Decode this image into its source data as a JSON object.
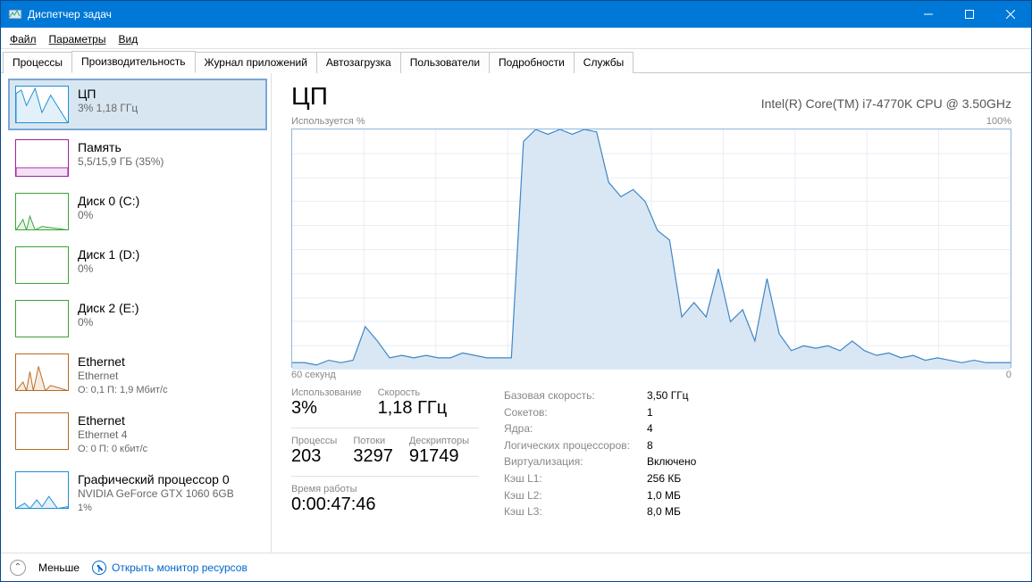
{
  "window": {
    "title": "Диспетчер задач"
  },
  "menu": {
    "file": "Файл",
    "options": "Параметры",
    "view": "Вид"
  },
  "tabs": {
    "processes": "Процессы",
    "performance": "Производительность",
    "apphistory": "Журнал приложений",
    "startup": "Автозагрузка",
    "users": "Пользователи",
    "details": "Подробности",
    "services": "Службы",
    "active": "performance"
  },
  "sidebar": {
    "items": [
      {
        "id": "cpu",
        "title": "ЦП",
        "sub": "3%  1,18 ГГц",
        "color": "#1e90d4"
      },
      {
        "id": "memory",
        "title": "Память",
        "sub": "5,5/15,9 ГБ (35%)",
        "color": "#a020a0"
      },
      {
        "id": "disk0",
        "title": "Диск 0 (C:)",
        "sub": "0%",
        "color": "#3aa43a"
      },
      {
        "id": "disk1",
        "title": "Диск 1 (D:)",
        "sub": "0%",
        "color": "#3aa43a"
      },
      {
        "id": "disk2",
        "title": "Диск 2 (E:)",
        "sub": "0%",
        "color": "#3aa43a"
      },
      {
        "id": "eth0",
        "title": "Ethernet",
        "sub": "Ethernet",
        "sub2": "О: 0,1 П: 1,9 Мбит/с",
        "color": "#b86b1f"
      },
      {
        "id": "eth1",
        "title": "Ethernet",
        "sub": "Ethernet 4",
        "sub2": "О: 0 П: 0 кбит/с",
        "color": "#b86b1f"
      },
      {
        "id": "gpu",
        "title": "Графический процессор 0",
        "sub": "NVIDIA GeForce GTX 1060 6GB",
        "sub2": "1%",
        "color": "#1e90d4"
      }
    ]
  },
  "main": {
    "title": "ЦП",
    "device": "Intel(R) Core(TM) i7-4770K CPU @ 3.50GHz",
    "chart_top_left": "Используется %",
    "chart_top_right": "100%",
    "chart_bottom_left": "60 секунд",
    "chart_bottom_right": "0"
  },
  "stats": {
    "left_row1": [
      {
        "lbl": "Использование",
        "val": "3%"
      },
      {
        "lbl": "Скорость",
        "val": "1,18 ГГц"
      }
    ],
    "left_row2": [
      {
        "lbl": "Процессы",
        "val": "203"
      },
      {
        "lbl": "Потоки",
        "val": "3297"
      },
      {
        "lbl": "Дескрипторы",
        "val": "91749"
      }
    ],
    "uptime_lbl": "Время работы",
    "uptime_val": "0:00:47:46",
    "right": [
      {
        "k": "Базовая скорость:",
        "v": "3,50 ГГц"
      },
      {
        "k": "Сокетов:",
        "v": "1"
      },
      {
        "k": "Ядра:",
        "v": "4"
      },
      {
        "k": "Логических процессоров:",
        "v": "8"
      },
      {
        "k": "Виртуализация:",
        "v": "Включено"
      },
      {
        "k": "Кэш L1:",
        "v": "256 КБ"
      },
      {
        "k": "Кэш L2:",
        "v": "1,0 МБ"
      },
      {
        "k": "Кэш L3:",
        "v": "8,0 МБ"
      }
    ]
  },
  "footer": {
    "fewer": "Меньше",
    "open_monitor": "Открыть монитор ресурсов"
  },
  "chart_data": {
    "type": "area",
    "title": "Используется %",
    "xlabel": "60 секунд",
    "ylabel": "",
    "ylim": [
      0,
      100
    ],
    "xlim": [
      60,
      0
    ],
    "values": [
      3,
      3,
      2,
      4,
      3,
      4,
      18,
      12,
      5,
      6,
      5,
      6,
      5,
      5,
      7,
      6,
      5,
      5,
      5,
      95,
      100,
      98,
      100,
      98,
      100,
      99,
      78,
      72,
      75,
      70,
      58,
      54,
      22,
      28,
      22,
      42,
      20,
      25,
      12,
      38,
      15,
      8,
      10,
      9,
      10,
      8,
      12,
      8,
      6,
      7,
      5,
      6,
      4,
      5,
      4,
      3,
      4,
      3,
      3,
      3
    ]
  }
}
